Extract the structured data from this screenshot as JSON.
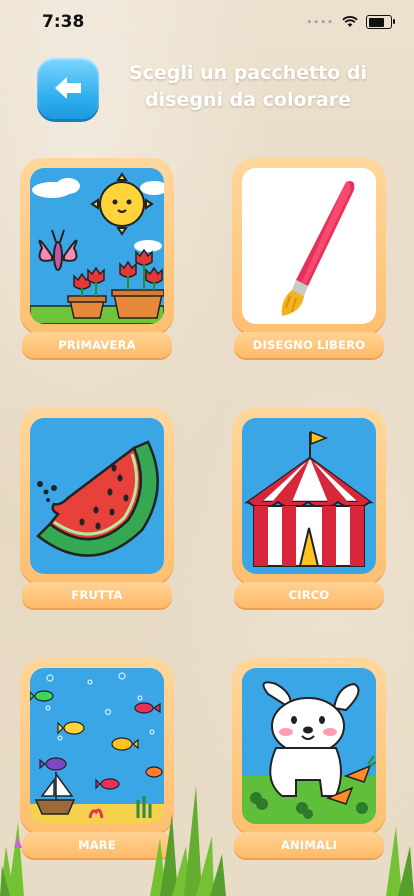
{
  "status_bar": {
    "time": "7:38",
    "signal_dots": "••••"
  },
  "header": {
    "back_icon": "arrow-left-icon",
    "title": "Scegli un pacchetto di disegni da colorare"
  },
  "packs": [
    {
      "label": "PRIMAVERA"
    },
    {
      "label": "DISEGNO LIBERO"
    },
    {
      "label": "FRUTTA"
    },
    {
      "label": "CIRCO"
    },
    {
      "label": "MARE"
    },
    {
      "label": "ANIMALI"
    }
  ],
  "colors": {
    "accent_orange": "#ffbf70",
    "back_button_blue": "#34b2f0",
    "sky_blue": "#3aa6e6",
    "background": "#e8dcc7"
  }
}
